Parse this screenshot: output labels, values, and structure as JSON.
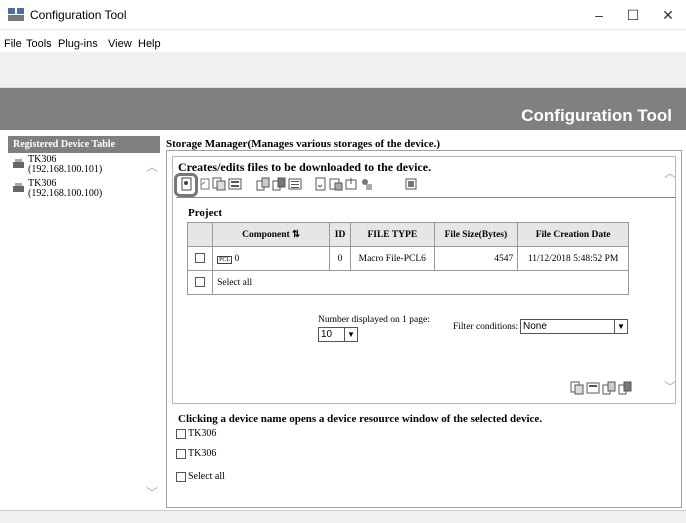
{
  "window": {
    "title": "Configuration Tool",
    "controls": {
      "minimize": "–",
      "maximize": "☐",
      "close": "✕"
    }
  },
  "menu": [
    "File",
    "Tools",
    "Plug-ins",
    "View",
    "Help"
  ],
  "banner": {
    "title": "Configuration Tool"
  },
  "left_panel": {
    "tab_label": "Registered Device Table",
    "devices": [
      {
        "name": "TK306",
        "ip": "(192.168.100.101)"
      },
      {
        "name": "TK306",
        "ip": "(192.168.100.100)"
      }
    ]
  },
  "storage": {
    "title": "Storage Manager(Manages various storages of the device.)",
    "section_title": "Creates/edits files to be downloaded to the device.",
    "project_label": "Project",
    "table": {
      "headers": [
        "Component",
        "ID",
        "FILE TYPE",
        "File Size(Bytes)",
        "File Creation Date"
      ],
      "rows": [
        {
          "component_icon": "PCL",
          "component": "0",
          "id": "0",
          "file_type": "Macro File-PCL6",
          "size": "4547",
          "date": "11/12/2018 5:48:52 PM"
        }
      ],
      "select_all": "Select all"
    },
    "paging": {
      "label": "Number displayed on 1 page:",
      "value": "10"
    },
    "filter": {
      "label": "Filter conditions:",
      "value": "None"
    }
  },
  "resource": {
    "title": "Clicking a device name opens a device resource window of the selected device.",
    "devices": [
      "TK306",
      "TK306"
    ],
    "select_all": "Select all"
  },
  "colors": {
    "banner": "#808080",
    "tab": "#7f7f7f",
    "highlight": "#777777"
  }
}
